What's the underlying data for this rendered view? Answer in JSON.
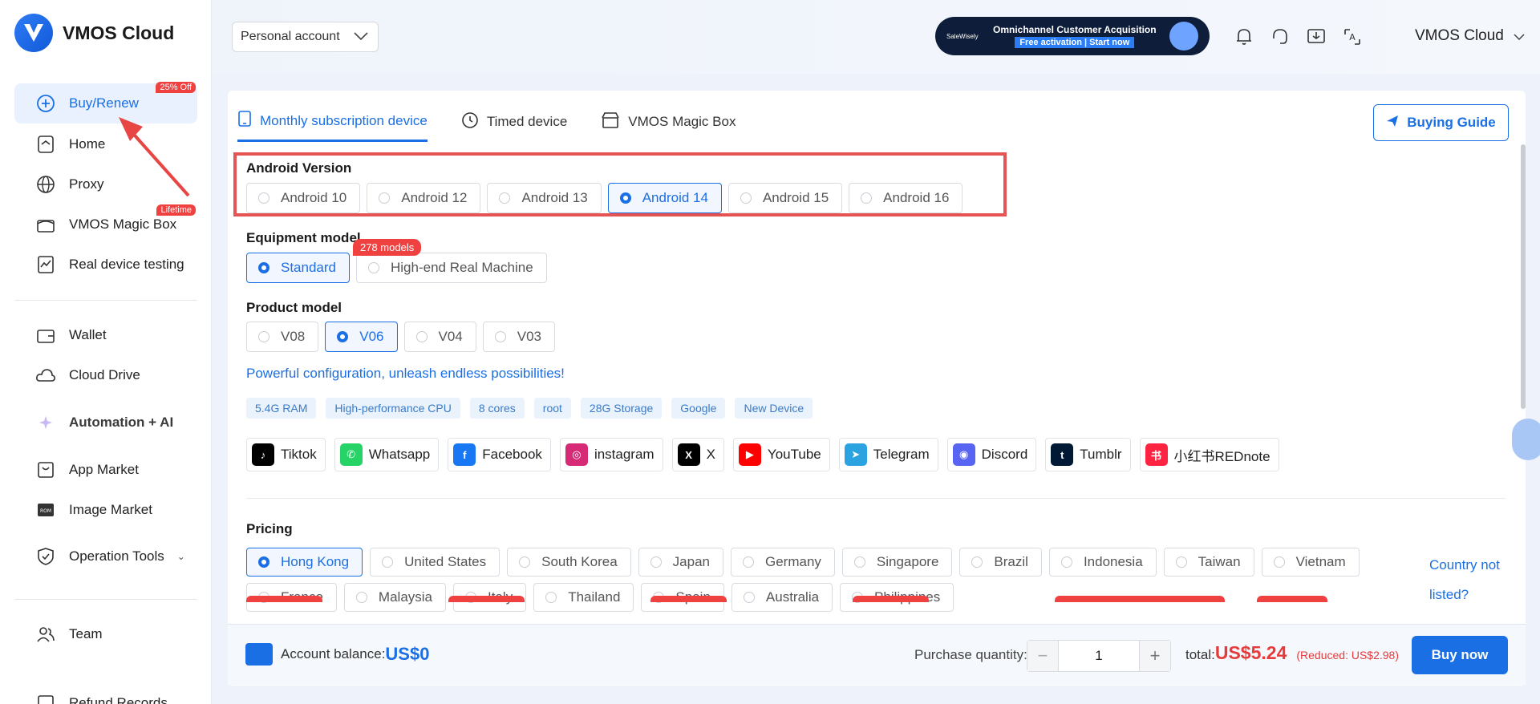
{
  "app": {
    "name": "VMOS Cloud"
  },
  "sidebar": {
    "items": [
      {
        "label": "Buy/Renew",
        "icon": "plus-circle-icon",
        "badge": "25% Off"
      },
      {
        "label": "Home",
        "icon": "home-icon"
      },
      {
        "label": "Proxy",
        "icon": "globe-icon"
      },
      {
        "label": "VMOS Magic Box",
        "icon": "box-icon",
        "badge": "Lifetime"
      },
      {
        "label": "Real device testing",
        "icon": "chart-icon"
      },
      {
        "label": "Wallet",
        "icon": "wallet-icon"
      },
      {
        "label": "Cloud Drive",
        "icon": "cloud-icon"
      },
      {
        "label": "Automation + AI",
        "icon": "sparkle-icon"
      },
      {
        "label": "App Market",
        "icon": "market-icon"
      },
      {
        "label": "Image Market",
        "icon": "rom-icon"
      },
      {
        "label": "Operation Tools",
        "icon": "shield-icon"
      },
      {
        "label": "Team",
        "icon": "team-icon"
      },
      {
        "label": "Refund Records",
        "icon": "refund-icon"
      }
    ]
  },
  "topbar": {
    "account_select": "Personal account",
    "promo": {
      "brand": "SaleWisely",
      "line1": "Omnichannel Customer Acquisition",
      "line2": "Free activation | Start now"
    },
    "user": "VMOS Cloud"
  },
  "tabs": [
    {
      "label": "Monthly subscription device",
      "icon": "tablet-icon"
    },
    {
      "label": "Timed device",
      "icon": "clock-icon"
    },
    {
      "label": "VMOS Magic Box",
      "icon": "store-icon"
    }
  ],
  "buying_guide": "Buying Guide",
  "android": {
    "label": "Android Version",
    "options": [
      "Android 10",
      "Android 12",
      "Android 13",
      "Android 14",
      "Android 15",
      "Android 16"
    ],
    "selected": "Android 14"
  },
  "equipment": {
    "label": "Equipment model",
    "options": [
      "Standard",
      "High-end Real Machine"
    ],
    "selected": "Standard",
    "badge": "278 models"
  },
  "product": {
    "label": "Product model",
    "options": [
      "V08",
      "V06",
      "V04",
      "V03"
    ],
    "selected": "V06"
  },
  "tagline": "Powerful configuration, unleash endless possibilities!",
  "specs": [
    "5.4G RAM",
    "High-performance CPU",
    "8 cores",
    "root",
    "28G Storage",
    "Google",
    "New Device"
  ],
  "apps": [
    {
      "name": "Tiktok",
      "color": "#000000",
      "glyph": "♪"
    },
    {
      "name": "Whatsapp",
      "color": "#25d366",
      "glyph": "✆"
    },
    {
      "name": "Facebook",
      "color": "#1877f2",
      "glyph": "f"
    },
    {
      "name": "instagram",
      "color": "#d62976",
      "glyph": "◎"
    },
    {
      "name": "X",
      "color": "#000000",
      "glyph": "X"
    },
    {
      "name": "YouTube",
      "color": "#ff0000",
      "glyph": "▶"
    },
    {
      "name": "Telegram",
      "color": "#2aa3e0",
      "glyph": "➤"
    },
    {
      "name": "Discord",
      "color": "#5865f2",
      "glyph": "◉"
    },
    {
      "name": "Tumblr",
      "color": "#001935",
      "glyph": "t"
    },
    {
      "name": "小红书REDnote",
      "color": "#ff2442",
      "glyph": "书"
    }
  ],
  "pricing": {
    "label": "Pricing",
    "countries": [
      "Hong Kong",
      "United States",
      "South Korea",
      "Japan",
      "Germany",
      "Singapore",
      "Brazil",
      "Indonesia",
      "Taiwan",
      "Vietnam",
      "France",
      "Malaysia",
      "Italy",
      "Thailand",
      "Spain",
      "Australia",
      "Philippines"
    ],
    "selected": "Hong Kong",
    "not_listed": "Country not listed?"
  },
  "bottom": {
    "balance_label": "Account balance:",
    "balance": "US$0",
    "qty_label": "Purchase quantity:",
    "qty": "1",
    "total_label": "total:",
    "total": "US$5.24",
    "reduced": "(Reduced: US$2.98)",
    "buy": "Buy now"
  },
  "colors": {
    "accent": "#1a6fe5",
    "danger": "#f04141",
    "price": "#e53b3b"
  }
}
